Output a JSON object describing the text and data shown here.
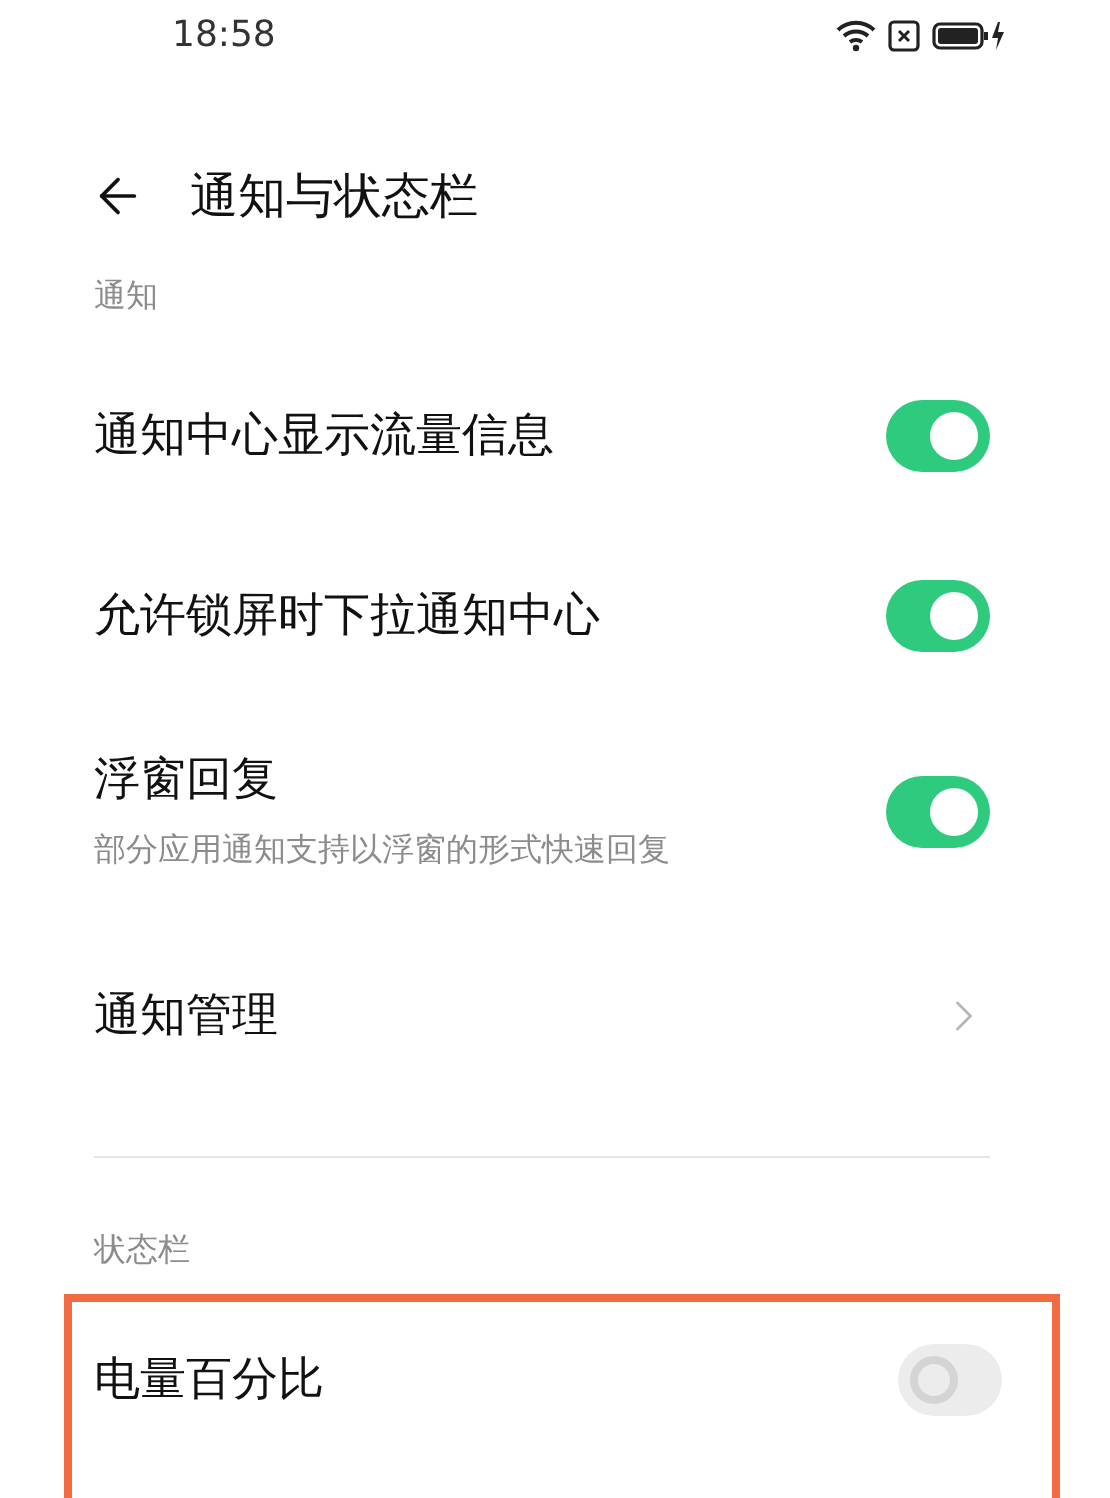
{
  "status_bar": {
    "time": "18:58"
  },
  "header": {
    "title": "通知与状态栏"
  },
  "sections": [
    {
      "title": "通知",
      "items": [
        {
          "kind": "toggle",
          "label": "通知中心显示流量信息",
          "on": true,
          "highlighted": false
        },
        {
          "kind": "toggle",
          "label": "允许锁屏时下拉通知中心",
          "on": true,
          "highlighted": false
        },
        {
          "kind": "toggle",
          "label": "浮窗回复",
          "subtitle": "部分应用通知支持以浮窗的形式快速回复",
          "on": true,
          "highlighted": false
        },
        {
          "kind": "link",
          "label": "通知管理",
          "highlighted": false
        }
      ]
    },
    {
      "title": "状态栏",
      "items": [
        {
          "kind": "toggle",
          "label": "电量百分比",
          "on": false,
          "highlighted": true
        }
      ]
    }
  ]
}
